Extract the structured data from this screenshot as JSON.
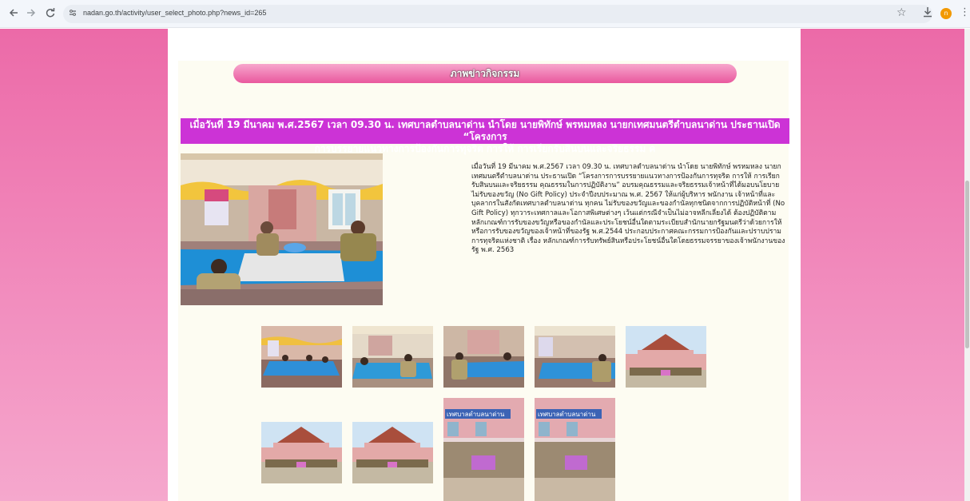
{
  "browser": {
    "url": "nadan.go.th/activity/user_select_photo.php?news_id=265",
    "profile_initial": "n",
    "back_icon": "arrow-left-icon",
    "forward_icon": "arrow-right-icon",
    "reload_icon": "reload-icon"
  },
  "page": {
    "section_heading": "ภาพข่าวกิจกรรม",
    "news_title_line1": "เมื่อวันที่ 19 มีนาคม พ.ศ.2567 เวลา 09.30 น. เทศบาลตำบลนาด่าน นำโดย นายพิทักษ์ พรหมหลง นายกเทศมนตรีตำบลนาด่าน ประธานเปิด “โครงการ",
    "news_title_line2": "การบรรยายแนวทางการป้องกันการทุจริต การให้ การเรียกรับสินบนและจริยธรรม ค",
    "description": "เมื่อวันที่ 19 มีนาคม พ.ศ.2567 เวลา 09.30 น. เทศบาลตำบลนาด่าน นำโดย นายพิทักษ์ พรหมหลง นายกเทศมนตรีตำบลนาด่าน ประธานเปิด “โครงการการบรรยายแนวทางการป้องกันการทุจริต การให้ การเรียกรับสินบนและจริยธรรม คุณธรรมในการปฏิบัติงาน” อบรมคุณธรรมและจริยธรรมเจ้าหน้าที่ได้มอบนโยบายไม่รับของขวัญ (No Gift Policy) ประจำปีงบประมาณ พ.ศ. 2567 ให้แก่ผู้บริหาร พนักงาน เจ้าหน้าที่และบุคลากรในสังกัดเทศบาลตำบลนาด่าน ทุกคน ไม่รับของขวัญและของกำนัลทุกชนิดจากการปฏิบัติหน้าที่ (No Gift Policy) ทุกวาระเทศกาลและโอกาสพิเศษต่างๆ เว้นแต่กรณีจำเป็นไม่อาจหลีกเลี่ยงได้ ต้องปฏิบัติตามหลักเกณฑ์การรับของขวัญหรือของกำนัลและประโยชน์อื่นใดตามระเบียบสำนักนายกรัฐมนตรีว่าด้วยการให้หรือการรับของขวัญของเจ้าหน้าที่ของรัฐ พ.ศ.2544 ประกอบประกาศคณะกรรมการป้องกันและปราบปรามการทุจริตแห่งชาติ เรื่อง หลักเกณฑ์การรับทรัพย์สินหรือประโยชน์อื่นใดโดยธรรมจรรยาของเจ้าพนักงานของรัฐ พ.ศ. 2563",
    "building_sign": "เทศบาลตำบลนาด่าน"
  },
  "colors": {
    "page_bg": "#ec6aa8",
    "title_bar": "#cc33d6",
    "heading_pill": "#e9589e"
  }
}
